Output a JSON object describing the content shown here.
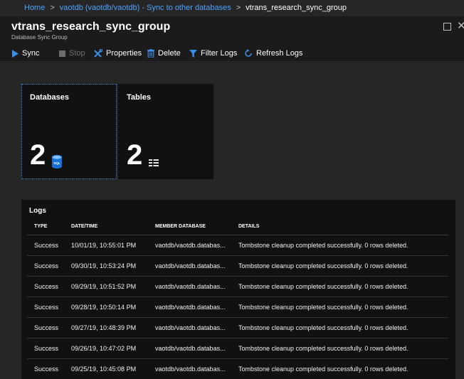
{
  "breadcrumb": {
    "items": [
      "Home",
      "vaotdb (vaotdb/vaotdb) - Sync to other databases"
    ],
    "current": "vtrans_research_sync_group",
    "separator": ">"
  },
  "blade": {
    "title": "vtrans_research_sync_group",
    "subtitle": "Database Sync Group"
  },
  "toolbar": {
    "sync_label": "Sync",
    "stop_label": "Stop",
    "properties_label": "Properties",
    "delete_label": "Delete",
    "filter_logs_label": "Filter Logs",
    "refresh_logs_label": "Refresh Logs"
  },
  "tiles": [
    {
      "title": "Databases",
      "count": "2",
      "icon": "sql-database-icon",
      "icon_text": "SQL"
    },
    {
      "title": "Tables",
      "count": "2",
      "icon": "table-icon"
    }
  ],
  "logs": {
    "title": "Logs",
    "columns": [
      "TYPE",
      "DATE/TIME",
      "MEMBER DATABASE",
      "DETAILS"
    ],
    "rows": [
      [
        "Success",
        "10/01/19, 10:55:01 PM",
        "vaotdb/vaotdb.databas...",
        "Tombstone cleanup completed successfully. 0 rows deleted."
      ],
      [
        "Success",
        "09/30/19, 10:53:24 PM",
        "vaotdb/vaotdb.databas...",
        "Tombstone cleanup completed successfully. 0 rows deleted."
      ],
      [
        "Success",
        "09/29/19, 10:51:52 PM",
        "vaotdb/vaotdb.databas...",
        "Tombstone cleanup completed successfully. 0 rows deleted."
      ],
      [
        "Success",
        "09/28/19, 10:50:14 PM",
        "vaotdb/vaotdb.databas...",
        "Tombstone cleanup completed successfully. 0 rows deleted."
      ],
      [
        "Success",
        "09/27/19, 10:48:39 PM",
        "vaotdb/vaotdb.databas...",
        "Tombstone cleanup completed successfully. 0 rows deleted."
      ],
      [
        "Success",
        "09/26/19, 10:47:02 PM",
        "vaotdb/vaotdb.databas...",
        "Tombstone cleanup completed successfully. 0 rows deleted."
      ],
      [
        "Success",
        "09/25/19, 10:45:08 PM",
        "vaotdb/vaotdb.databas...",
        "Tombstone cleanup completed successfully. 0 rows deleted."
      ]
    ]
  },
  "colors": {
    "accent": "#3c8ee8",
    "link": "#4ea3ff",
    "background": "#262626",
    "panel": "#111111"
  }
}
